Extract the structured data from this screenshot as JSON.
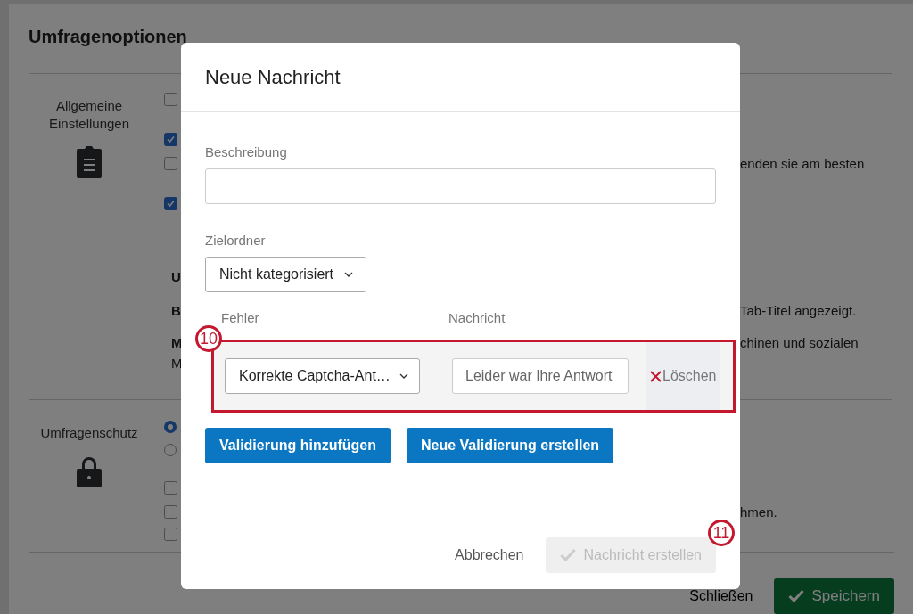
{
  "background": {
    "title": "Umfragenoptionen",
    "sections": [
      {
        "label": "Allgemeine Einstellungen",
        "rows": [
          {
            "kind": "checkbox",
            "checked": false
          },
          {
            "kind": "checkbox",
            "checked": true
          },
          {
            "kind": "checkbox",
            "checked": false,
            "tail": "enden sie am besten"
          },
          {
            "kind": "checkbox",
            "checked": true
          },
          {
            "kind": "text",
            "lead": "U"
          },
          {
            "kind": "text",
            "lead": "B",
            "tail": "Tab-Titel angezeigt."
          },
          {
            "kind": "text",
            "lead": "M",
            "tail": "chinen und sozialen"
          },
          {
            "kind": "plain",
            "lead": "M"
          }
        ]
      },
      {
        "label": "Umfragenschutz",
        "rows": [
          {
            "kind": "radio",
            "selected": true
          },
          {
            "kind": "radio",
            "selected": false
          },
          {
            "kind": "checkbox",
            "checked": false
          },
          {
            "kind": "checkbox",
            "checked": false,
            "tail": "hmen."
          },
          {
            "kind": "checkbox",
            "checked": false
          }
        ]
      }
    ],
    "footer": {
      "close": "Schließen",
      "save": "Speichern"
    }
  },
  "dialog": {
    "title": "Neue Nachricht",
    "description": {
      "label": "Beschreibung"
    },
    "folder": {
      "label": "Zielordner",
      "value": "Nicht kategorisiert"
    },
    "columns": [
      "Fehler",
      "Nachricht"
    ],
    "validations": [
      {
        "error": "Korrekte Captcha-Ant…",
        "message": "Leider war Ihre Antwort",
        "delete": "Löschen"
      }
    ],
    "buttons": [
      "Validierung hinzufügen",
      "Neue Validierung erstellen"
    ],
    "cancel": "Abbrechen",
    "create": {
      "label": "Nachricht erstellen",
      "disabled": true
    }
  },
  "annotations": [
    {
      "label": "10"
    },
    {
      "label": "11"
    }
  ]
}
